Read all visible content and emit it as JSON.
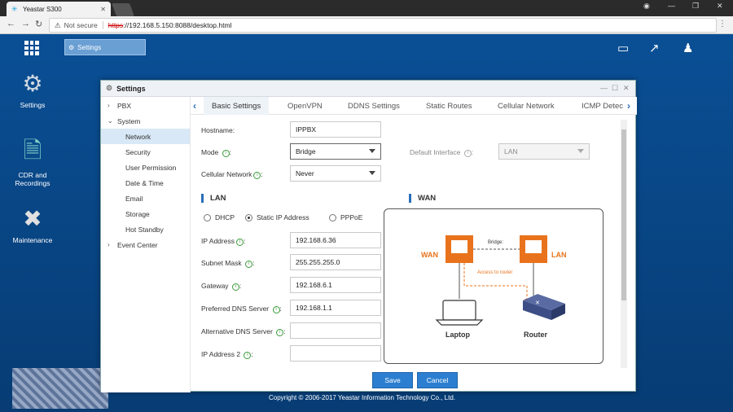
{
  "browser": {
    "tab_title": "Yeastar S300",
    "warning": "Not secure",
    "url_scheme": "https",
    "url_rest": "://192.168.5.150:8088/desktop.html"
  },
  "desktop": {
    "taskbar_item": "Settings",
    "icons": [
      {
        "label": "Settings",
        "icon": "gear-icon"
      },
      {
        "label": "CDR and Recordings",
        "icon": "cdr-icon"
      },
      {
        "label": "Maintenance",
        "icon": "tools-icon"
      }
    ],
    "copyright": "Copyright © 2006-2017 Yeastar Information Technology Co., Ltd."
  },
  "dialog": {
    "title": "Settings",
    "sidebar": [
      {
        "label": "PBX",
        "level": "top",
        "arrow": "›"
      },
      {
        "label": "System",
        "level": "top",
        "arrow": "⌄"
      },
      {
        "label": "Network",
        "level": "sub",
        "active": true
      },
      {
        "label": "Security",
        "level": "sub"
      },
      {
        "label": "User Permission",
        "level": "sub"
      },
      {
        "label": "Date & Time",
        "level": "sub"
      },
      {
        "label": "Email",
        "level": "sub"
      },
      {
        "label": "Storage",
        "level": "sub"
      },
      {
        "label": "Hot Standby",
        "level": "sub"
      },
      {
        "label": "Event Center",
        "level": "top",
        "arrow": "›"
      }
    ],
    "tabs": [
      "Basic Settings",
      "OpenVPN",
      "DDNS Settings",
      "Static Routes",
      "Cellular Network",
      "ICMP Detec"
    ],
    "form": {
      "hostname_label": "Hostname:",
      "hostname_value": "IPPBX",
      "mode_label": "Mode",
      "mode_value": "Bridge",
      "default_interface_label": "Default Interface",
      "default_interface_value": "LAN",
      "cellular_label": "Cellular Network",
      "cellular_value": "Never",
      "lan_section": "LAN",
      "wan_section": "WAN",
      "radio_dhcp": "DHCP",
      "radio_static": "Static IP Address",
      "radio_pppoe": "PPPoE",
      "ip_label": "IP Address",
      "ip_value": "192.168.6.36",
      "subnet_label": "Subnet Mask",
      "subnet_value": "255.255.255.0",
      "gateway_label": "Gateway",
      "gateway_value": "192.168.6.1",
      "pdns_label": "Preferred DNS Server",
      "pdns_value": "192.168.1.1",
      "adns_label": "Alternative DNS Server",
      "adns_value": "",
      "ip2_label": "IP Address 2",
      "ip2_value": ""
    },
    "diagram": {
      "wan": "WAN",
      "lan": "LAN",
      "bridge": "Bridge",
      "access": "Access to router",
      "laptop": "Laptop",
      "router": "Router"
    },
    "buttons": {
      "save": "Save",
      "cancel": "Cancel"
    }
  },
  "colors": {
    "accent": "#2a6ebb",
    "orange": "#e8731c",
    "button": "#2c7fd0"
  }
}
